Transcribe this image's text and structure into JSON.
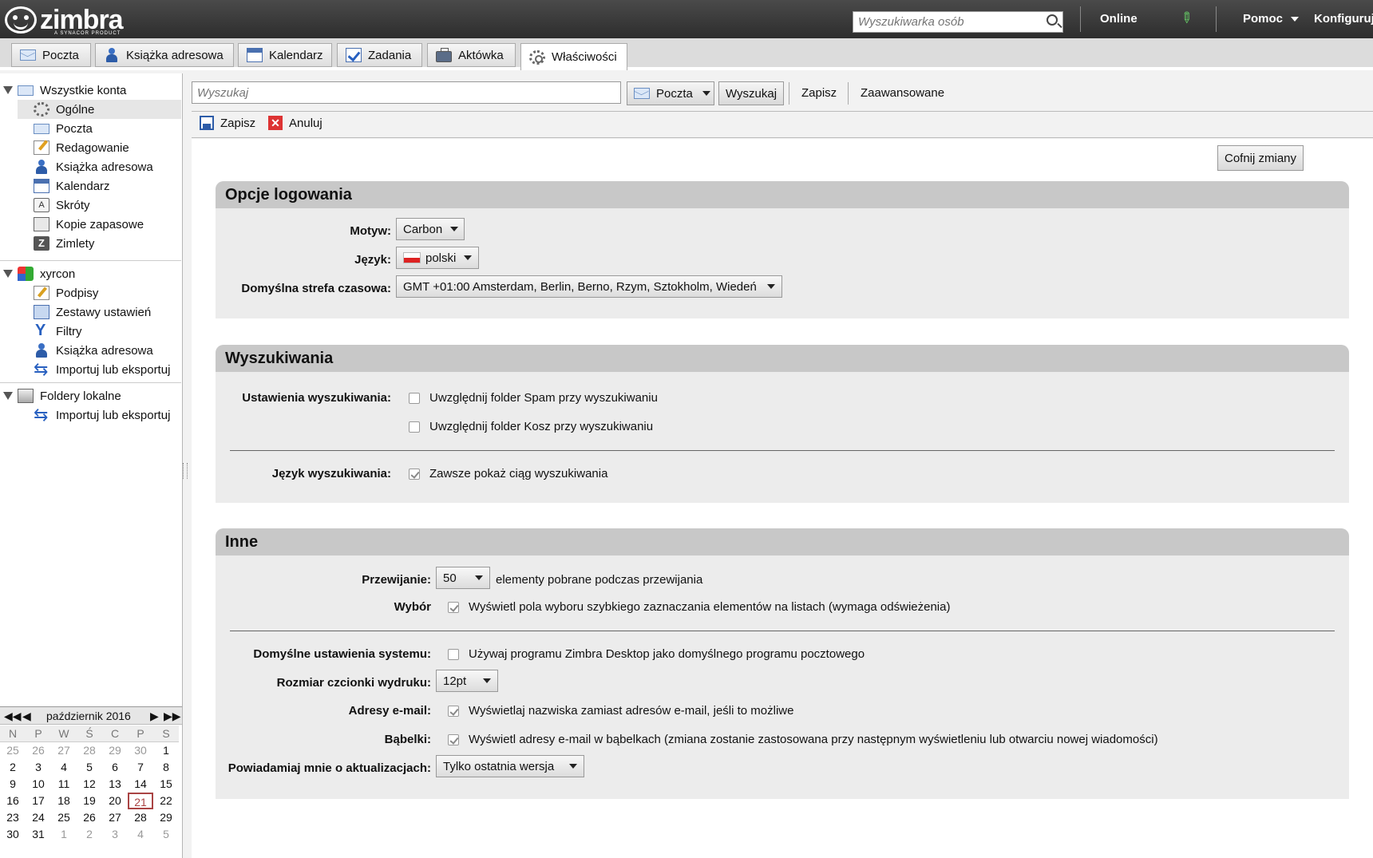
{
  "brand": {
    "name": "zimbra",
    "tagline": "A SYNACOR PRODUCT"
  },
  "topbar": {
    "people_search_placeholder": "Wyszukiwarka osób",
    "status": "Online",
    "help": "Pomoc",
    "configure": "Konfiguruj"
  },
  "apptabs": [
    {
      "label": "Poczta",
      "icon": "mail-icon"
    },
    {
      "label": "Książka adresowa",
      "icon": "contacts-icon"
    },
    {
      "label": "Kalendarz",
      "icon": "calendar-icon"
    },
    {
      "label": "Zadania",
      "icon": "tasks-icon"
    },
    {
      "label": "Aktówka",
      "icon": "briefcase-icon"
    },
    {
      "label": "Właściwości",
      "icon": "gear-icon",
      "active": true
    }
  ],
  "sidebar": {
    "all_accounts": {
      "label": "Wszystkie konta",
      "items": [
        "Ogólne",
        "Poczta",
        "Redagowanie",
        "Książka adresowa",
        "Kalendarz",
        "Skróty",
        "Kopie zapasowe",
        "Zimlety"
      ],
      "selected": "Ogólne"
    },
    "account": {
      "label": "xyrcon",
      "items": [
        "Podpisy",
        "Zestawy ustawień",
        "Filtry",
        "Książka adresowa",
        "Importuj lub eksportuj"
      ]
    },
    "local": {
      "label": "Foldery lokalne",
      "items": [
        "Importuj lub eksportuj"
      ]
    }
  },
  "minical": {
    "month": "październik 2016",
    "day_names": [
      "N",
      "P",
      "W",
      "Ś",
      "C",
      "P",
      "S"
    ],
    "weeks": [
      [
        "25",
        "26",
        "27",
        "28",
        "29",
        "30",
        "1"
      ],
      [
        "2",
        "3",
        "4",
        "5",
        "6",
        "7",
        "8"
      ],
      [
        "9",
        "10",
        "11",
        "12",
        "13",
        "14",
        "15"
      ],
      [
        "16",
        "17",
        "18",
        "19",
        "20",
        "21",
        "22"
      ],
      [
        "23",
        "24",
        "25",
        "26",
        "27",
        "28",
        "29"
      ],
      [
        "30",
        "31",
        "1",
        "2",
        "3",
        "4",
        "5"
      ]
    ],
    "today": "21"
  },
  "search": {
    "placeholder": "Wyszukaj",
    "scope": "Poczta",
    "search_btn": "Wyszukaj",
    "save": "Zapisz",
    "advanced": "Zaawansowane"
  },
  "toolbar": {
    "save": "Zapisz",
    "cancel": "Anuluj"
  },
  "main": {
    "revert": "Cofnij zmiany",
    "login": {
      "title": "Opcje logowania",
      "theme_label": "Motyw:",
      "theme_value": "Carbon",
      "lang_label": "Język:",
      "lang_value": "polski",
      "tz_label": "Domyślna strefa czasowa:",
      "tz_value": "GMT +01:00 Amsterdam, Berlin, Berno, Rzym, Sztokholm, Wiedeń"
    },
    "search": {
      "title": "Wyszukiwania",
      "settings_label": "Ustawienia wyszukiwania:",
      "spam": "Uwzględnij folder Spam przy wyszukiwaniu",
      "trash": "Uwzględnij folder Kosz przy wyszukiwaniu",
      "lang_label": "Język wyszukiwania:",
      "always_show": "Zawsze pokaż ciąg wyszukiwania"
    },
    "other": {
      "title": "Inne",
      "scroll_label": "Przewijanie:",
      "scroll_value": "50",
      "scroll_text": "elementy pobrane podczas przewijania",
      "select_label": "Wybór",
      "select_text": "Wyświetl pola wyboru szybkiego zaznaczania elementów na listach (wymaga odświeżenia)",
      "default_label": "Domyślne ustawienia systemu:",
      "default_text": "Używaj programu Zimbra Desktop jako domyślnego programu pocztowego",
      "font_label": "Rozmiar czcionki wydruku:",
      "font_value": "12pt",
      "email_label": "Adresy e-mail:",
      "email_text": "Wyświetlaj nazwiska zamiast adresów e-mail, jeśli to możliwe",
      "bubbles_label": "Bąbelki:",
      "bubbles_text": "Wyświetl adresy e-mail w bąbelkach (zmiana zostanie zastosowana przy następnym wyświetleniu lub otwarciu nowej wiadomości)",
      "notify_label": "Powiadamiaj mnie o aktualizacjach:",
      "notify_value": "Tylko ostatnia wersja"
    }
  }
}
